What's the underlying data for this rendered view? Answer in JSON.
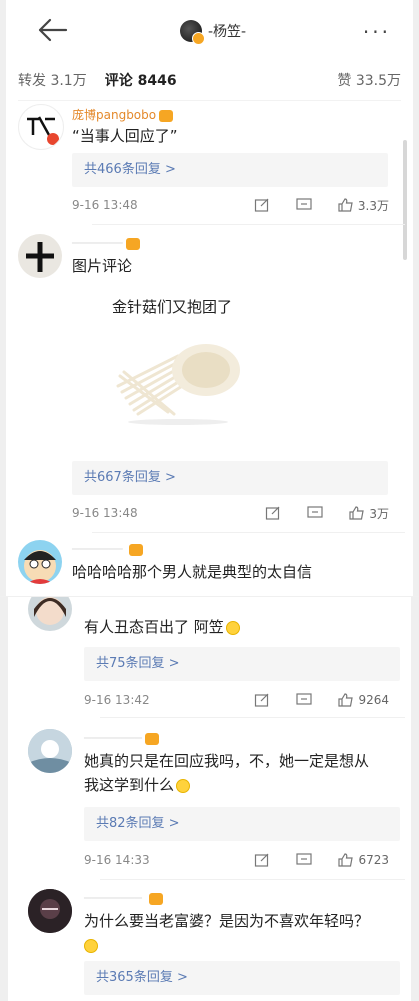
{
  "header": {
    "title": "-杨笠-",
    "more": "···"
  },
  "tabs": {
    "repost": "转发 3.1万",
    "comments": "评论 8446",
    "likes": "赞 33.5万"
  },
  "comments": [
    {
      "username": "庞博pangbobo",
      "text": "“当事人回应了”",
      "replies": "共466条回复 >",
      "time": "9-16 13:48",
      "likes": "3.3万"
    },
    {
      "username": "",
      "text": "图片评论",
      "image_caption": "金针菇们又抱团了",
      "replies": "共667条回复 >",
      "time": "9-16 13:48",
      "likes": "3万"
    },
    {
      "username": "",
      "text": "哈哈哈哈那个男人就是典型的太自信"
    }
  ],
  "comments2": [
    {
      "text": "有人丑态百出了 阿笠",
      "replies": "共75条回复 >",
      "time": "9-16 13:42",
      "likes": "9264"
    },
    {
      "text_line1": "她真的只是在回应我吗，不，她一定是想从",
      "text_line2": "我这学到什么",
      "replies": "共82条回复 >",
      "time": "9-16 14:33",
      "likes": "6723"
    },
    {
      "text": "为什么要当老富婆？是因为不喜欢年轻吗？",
      "replies": "共365条回复 >"
    }
  ],
  "colors": {
    "accent_name": "#e4892b",
    "reply_link": "#5b7bb4",
    "reply_bg": "#f5f5f5"
  }
}
